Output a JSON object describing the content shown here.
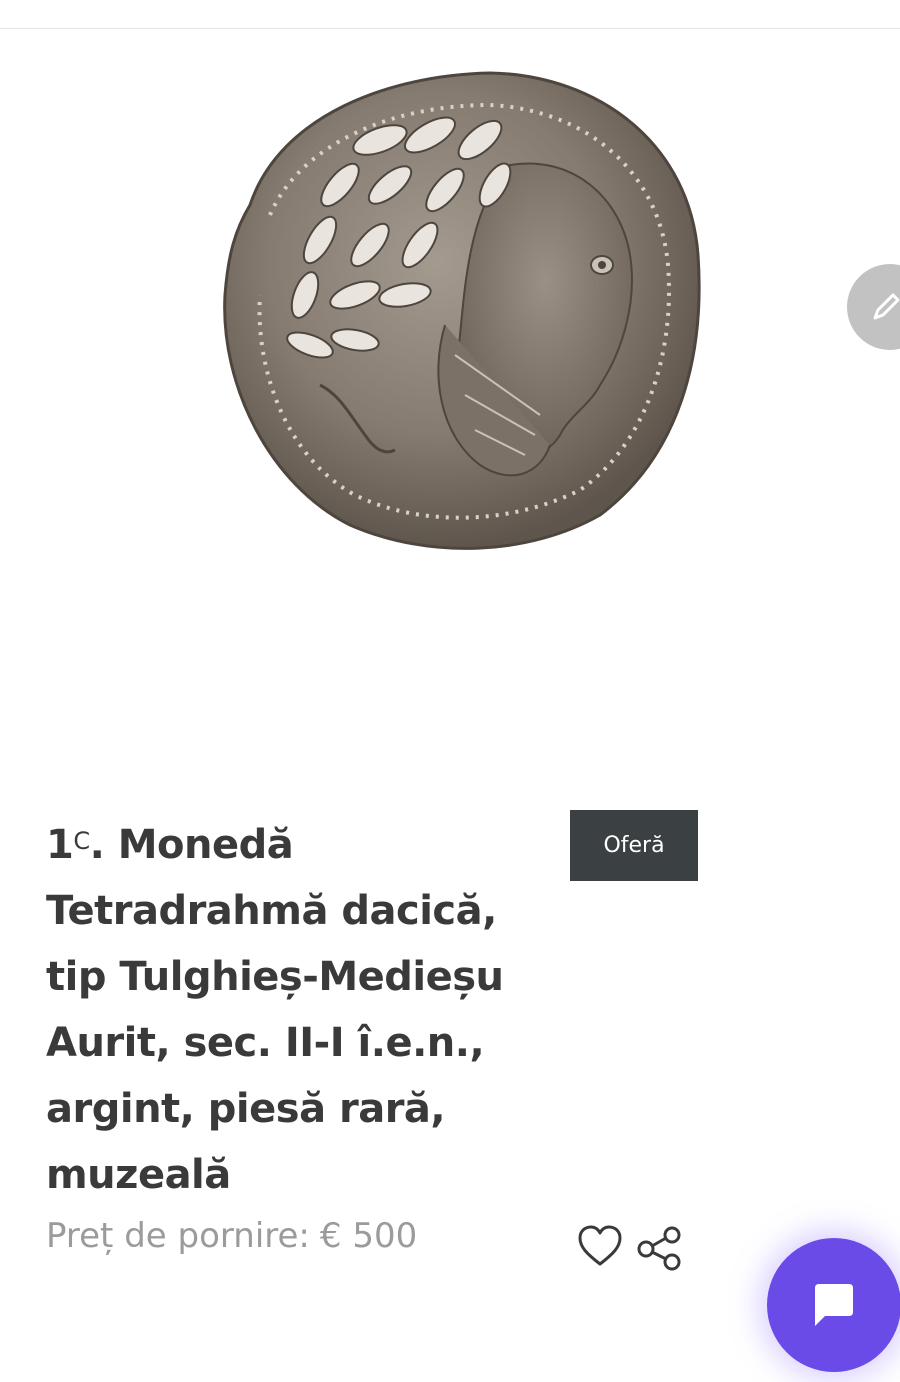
{
  "product": {
    "title_prefix": "1",
    "title_sup": "C",
    "title_text": ". Monedă Tetradrahmă dacică, tip Tulghieș-Medieșu Aurit, sec. II-I î.e.n., argint, piesă rară, muzeală",
    "price_label": "Preț de pornire:",
    "price_value": "€ 500"
  },
  "actions": {
    "offer_label": "Oferă"
  },
  "icons": {
    "edit": "pencil-icon",
    "favorite": "heart-icon",
    "share": "share-icon",
    "chat": "chat-bubble-icon"
  },
  "colors": {
    "offer_button_bg": "#3b4043",
    "chat_fab_bg": "#6a4be8",
    "edit_fab_bg": "#c2c2c2",
    "price_text": "#9b9b9b"
  }
}
